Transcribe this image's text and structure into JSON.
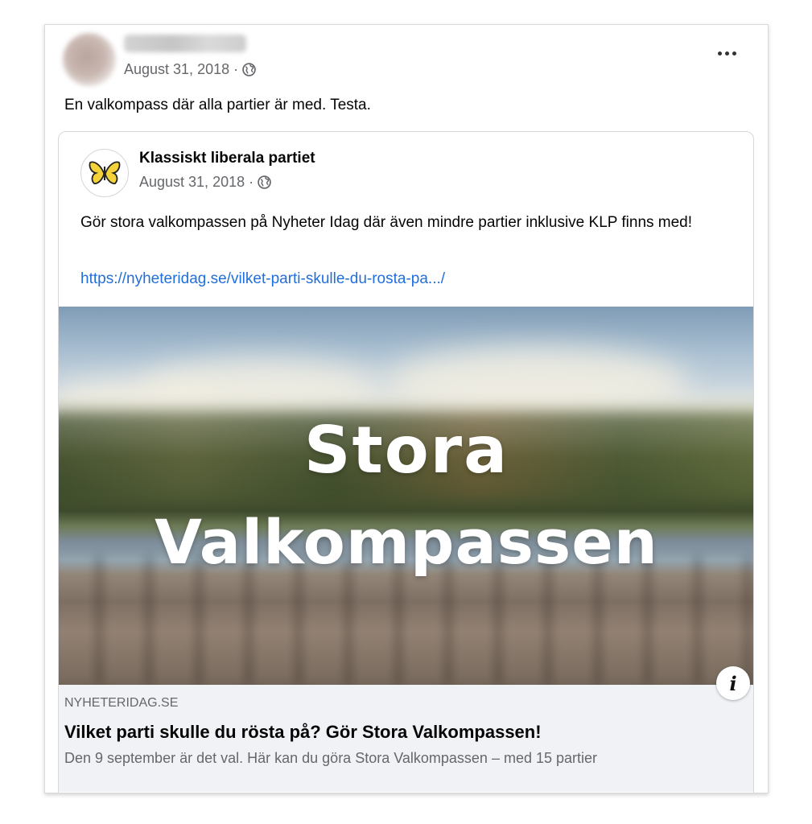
{
  "post": {
    "date": "August 31, 2018",
    "separator": "·",
    "text": "En valkompass där alla partier är med. Testa."
  },
  "shared_post": {
    "page_name": "Klassiskt liberala partiet",
    "date": "August 31, 2018",
    "separator": "·",
    "text": "Gör stora valkompassen på Nyheter Idag där även mindre partier inklusive KLP finns med!",
    "link": "https://nyheteridag.se/vilket-parti-skulle-du-rosta-pa.../"
  },
  "link_preview": {
    "image_text_line1": "Stora",
    "image_text_line2": "Valkompassen",
    "domain": "NYHETERIDAG.SE",
    "title": "Vilket parti skulle du rösta på? Gör Stora Valkompassen!",
    "description": "Den 9 september är det val. Här kan du göra Stora Valkompassen – med 15 partier",
    "info_icon_glyph": "i"
  },
  "icons": {
    "privacy": "globe-icon",
    "menu": "more-options-icon",
    "page_logo": "butterfly-icon",
    "info": "info-icon"
  },
  "colors": {
    "link": "#216fdb",
    "secondary_text": "#65676b",
    "footer_bg": "#f0f2f5",
    "butterfly": "#f3d23a"
  }
}
